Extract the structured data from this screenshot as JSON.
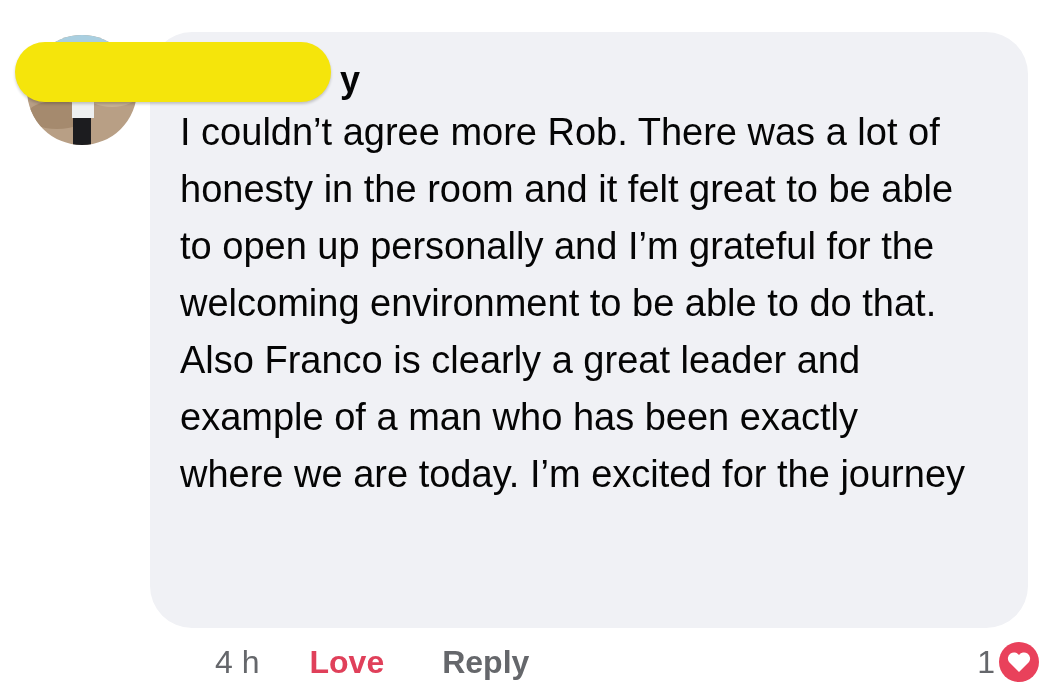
{
  "comment": {
    "author": "y",
    "author_redacted": true,
    "text": "I couldn’t agree more Rob. There was a lot of honesty in the room and it felt great to be able to open up personally and I’m grateful for the welcoming environment to be able to do that. Also Franco is clearly a great leader and example of a man who has been exactly where we are today. I’m excited for the journey"
  },
  "footer": {
    "time": "4 h",
    "actions": [
      {
        "label": "Love",
        "selected": true
      },
      {
        "label": "Reply",
        "selected": false
      }
    ],
    "reaction_count": "1"
  }
}
